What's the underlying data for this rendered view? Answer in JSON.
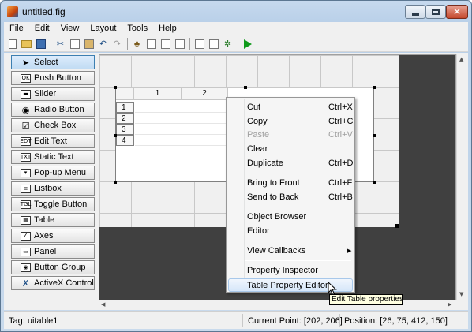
{
  "window": {
    "title": "untitled.fig"
  },
  "menubar": {
    "items": [
      "File",
      "Edit",
      "View",
      "Layout",
      "Tools",
      "Help"
    ]
  },
  "toolbar": {
    "icons": [
      "new-figure-icon",
      "open-file-icon",
      "save-icon",
      "cut-icon",
      "copy-icon",
      "paste-icon",
      "undo-icon",
      "redo-icon",
      "align-objects-icon",
      "menu-editor-icon",
      "tab-order-editor-icon",
      "toolbar-editor-icon",
      "editor-icon",
      "property-inspector-icon",
      "object-browser-icon",
      "run-figure-icon"
    ]
  },
  "palette": {
    "items": [
      {
        "label": "Select",
        "icon": "arrow-cursor-icon",
        "selected": true
      },
      {
        "label": "Push Button",
        "icon": "push-button-icon"
      },
      {
        "label": "Slider",
        "icon": "slider-icon"
      },
      {
        "label": "Radio Button",
        "icon": "radio-button-icon"
      },
      {
        "label": "Check Box",
        "icon": "check-box-icon"
      },
      {
        "label": "Edit Text",
        "icon": "edit-text-icon"
      },
      {
        "label": "Static Text",
        "icon": "static-text-icon"
      },
      {
        "label": "Pop-up Menu",
        "icon": "popup-menu-icon"
      },
      {
        "label": "Listbox",
        "icon": "listbox-icon"
      },
      {
        "label": "Toggle Button",
        "icon": "toggle-button-icon"
      },
      {
        "label": "Table",
        "icon": "table-icon"
      },
      {
        "label": "Axes",
        "icon": "axes-icon"
      },
      {
        "label": "Panel",
        "icon": "panel-icon"
      },
      {
        "label": "Button Group",
        "icon": "button-group-icon"
      },
      {
        "label": "ActiveX Control",
        "icon": "activex-icon"
      }
    ]
  },
  "table": {
    "columns": [
      "1",
      "2"
    ],
    "rows": [
      "1",
      "2",
      "3",
      "4"
    ]
  },
  "context_menu": {
    "items": [
      {
        "label": "Cut",
        "shortcut": "Ctrl+X"
      },
      {
        "label": "Copy",
        "shortcut": "Ctrl+C"
      },
      {
        "label": "Paste",
        "shortcut": "Ctrl+V",
        "disabled": true
      },
      {
        "label": "Clear",
        "shortcut": ""
      },
      {
        "label": "Duplicate",
        "shortcut": "Ctrl+D"
      },
      {
        "label": "Bring to Front",
        "shortcut": "Ctrl+F"
      },
      {
        "label": "Send to Back",
        "shortcut": "Ctrl+B"
      },
      {
        "label": "Object Browser",
        "shortcut": ""
      },
      {
        "label": "Editor",
        "shortcut": ""
      },
      {
        "label": "View Callbacks",
        "shortcut": "",
        "submenu": true
      },
      {
        "label": "Property Inspector",
        "shortcut": ""
      },
      {
        "label": "Table Property Editor...",
        "shortcut": "",
        "hover": true
      }
    ]
  },
  "tooltip": {
    "text": "Edit Table properties"
  },
  "statusbar": {
    "tag": "Tag: uitable1",
    "current_point": "Current Point:  [202, 206]",
    "position": "Position: [26, 75, 412, 150]"
  },
  "colors": {
    "workspace_dark": "#404040",
    "grid_bg": "#f0f0f0",
    "run_green": "#0f9a1b",
    "tooltip_bg": "#ffffe1"
  }
}
